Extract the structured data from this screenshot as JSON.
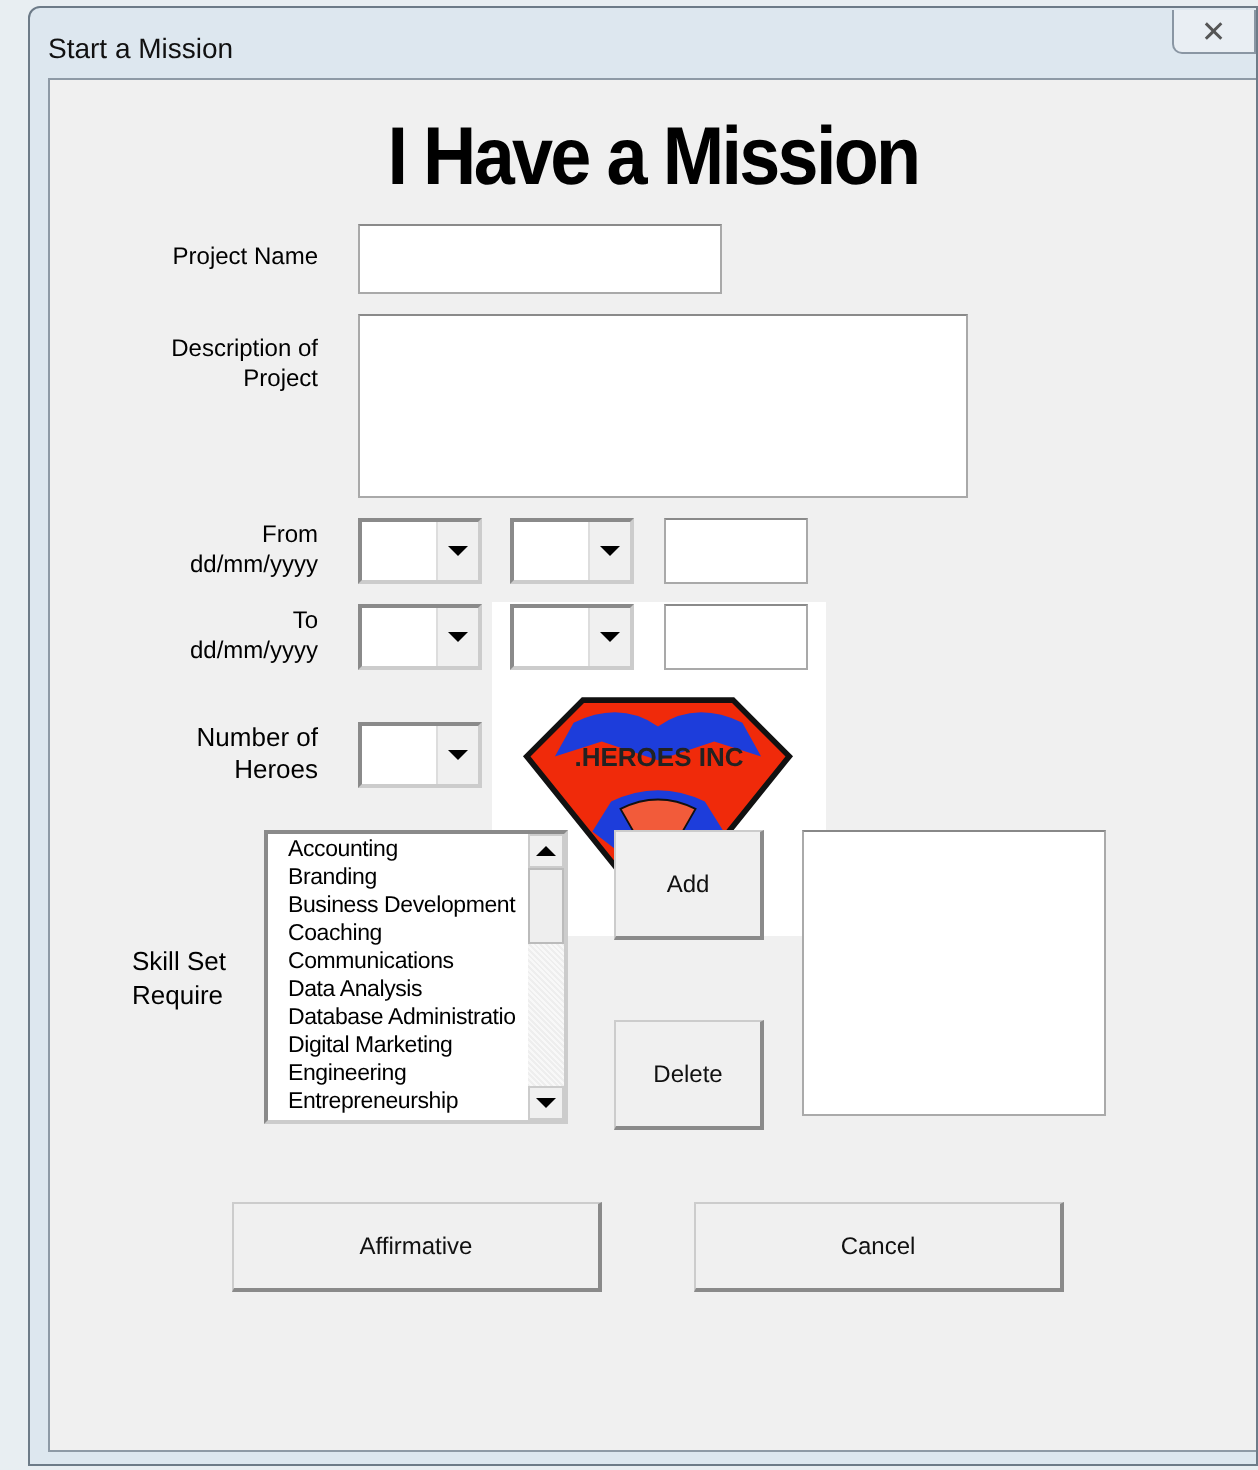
{
  "window": {
    "title": "Start a Mission",
    "close": "✕"
  },
  "heading": "I Have a Mission",
  "logo": {
    "text": ".HEROES INC"
  },
  "fields": [
    {
      "label": "Project Name",
      "kind": "text"
    },
    {
      "label": "Description of\nProject",
      "kind": "textarea"
    },
    {
      "label": "From\ndd/mm/yyyy",
      "kind": "date"
    },
    {
      "label": "To\ndd/mm/yyyy",
      "kind": "date"
    },
    {
      "label": "Number of\nHeroes",
      "kind": "combo"
    }
  ],
  "skills": {
    "label": "Skill Set\nRequire",
    "items": [
      "Accounting",
      "Branding",
      "Business Development",
      "Coaching",
      "Communications",
      "Data Analysis",
      "Database Administratio",
      "Digital Marketing",
      "Engineering",
      "Entrepreneurship"
    ],
    "add": "Add",
    "delete": "Delete"
  },
  "buttons": [
    "Affirmative",
    "Cancel"
  ]
}
